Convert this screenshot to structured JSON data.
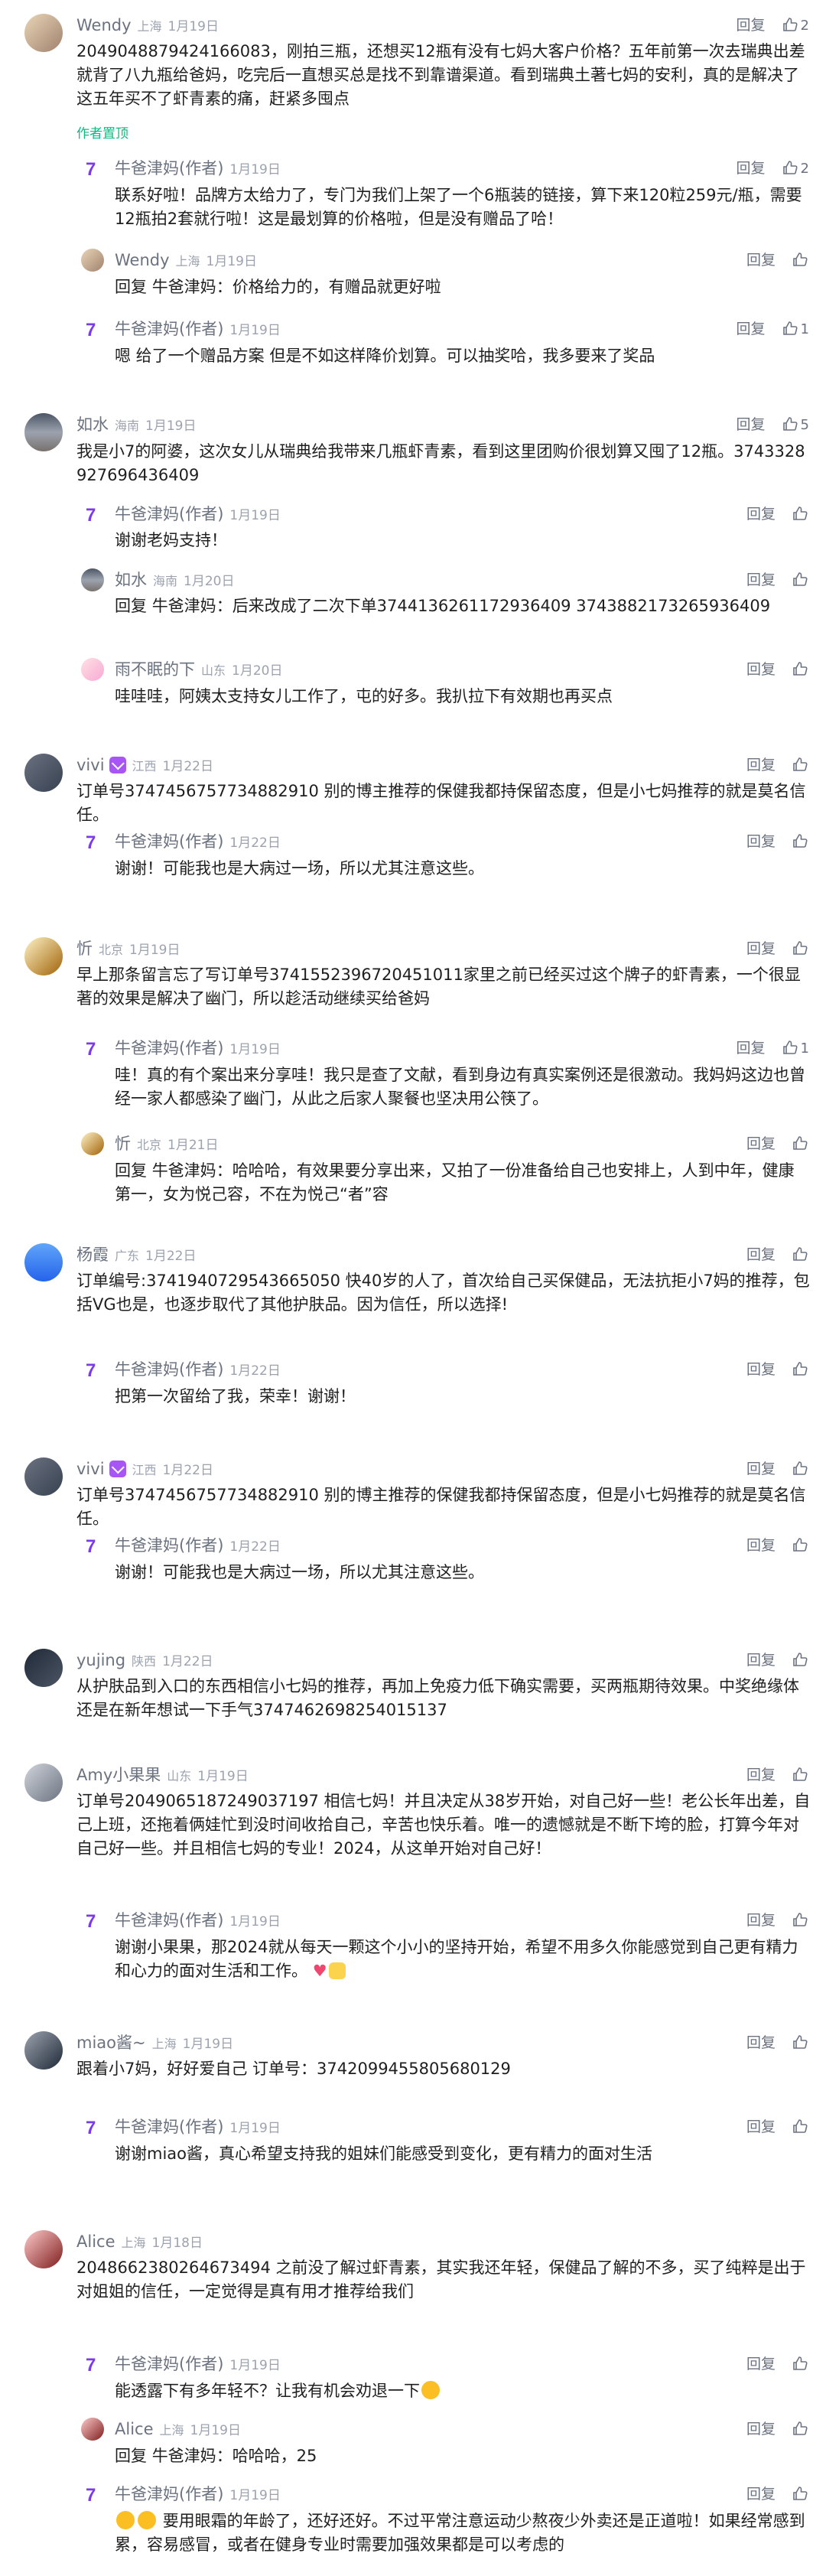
{
  "ui": {
    "reply_label": "回复",
    "author_tag": "(作者)",
    "reply_prefix": "回复",
    "favorite_tag": "作者置顶"
  },
  "colors": {
    "favorite": "#10b981",
    "vip": "#a855f7",
    "meta": "#9ca3af"
  },
  "comments": [
    {
      "user": "Wendy",
      "location": "上海",
      "date": "1月19日",
      "likes": "2",
      "text": "2049048879424166083，刚拍三瓶，还想买12瓶有没有七妈大客户价格？五年前第一次去瑞典出差就背了八九瓶给爸妈，吃完后一直想买总是找不到靠谱渠道。看到瑞典土著七妈的安利，真的是解决了这五年买不了虾青素的痛，赶紧多囤点",
      "replies": [
        {
          "user": "牛爸津妈",
          "location": "",
          "date": "1月19日",
          "likes": "2",
          "text": "联系好啦！品牌方太给力了，专门为我们上架了一个6瓶装的链接，算下来120粒259元/瓶，需要12瓶拍2套就行啦！这是最划算的价格啦，但是没有赠品了哈！"
        },
        {
          "user": "Wendy",
          "location": "上海",
          "date": "1月19日",
          "likes": "",
          "reply_to": "牛爸津妈",
          "text": "价格给力的，有赠品就更好啦"
        },
        {
          "user": "牛爸津妈",
          "location": "",
          "date": "1月19日",
          "likes": "1",
          "text": "嗯 给了一个赠品方案 但是不如这样降价划算。可以抽奖哈，我多要来了奖品"
        }
      ]
    },
    {
      "user": "如水",
      "location": "海南",
      "date": "1月19日",
      "likes": "5",
      "text": "我是小7的阿婆，这次女儿从瑞典给我带来几瓶虾青素，看到这里团购价很划算又囤了12瓶。3743328927696436409",
      "replies": [
        {
          "user": "牛爸津妈",
          "location": "",
          "date": "1月19日",
          "likes": "",
          "text": "谢谢老妈支持！"
        },
        {
          "user": "如水",
          "location": "海南",
          "date": "1月20日",
          "likes": "",
          "reply_to": "牛爸津妈",
          "text": "后来改成了二次下单3744136261172936409 3743882173265936409"
        },
        {
          "user": "雨不眠的下",
          "location": "山东",
          "date": "1月20日",
          "likes": "",
          "text": "哇哇哇，阿姨太支持女儿工作了，屯的好多。我扒拉下有效期也再买点"
        }
      ]
    },
    {
      "user": "vivi",
      "location": "江西",
      "date": "1月22日",
      "likes": "",
      "text": "订单号3747456757734882910 别的博主推荐的保健我都持保留态度，但是小七妈推荐的就是莫名信任。",
      "replies": [
        {
          "user": "牛爸津妈",
          "location": "",
          "date": "1月22日",
          "likes": "",
          "text": "谢谢！可能我也是大病过一场，所以尤其注意这些。"
        }
      ]
    },
    {
      "user": "忻",
      "location": "北京",
      "date": "1月19日",
      "likes": "",
      "text": "早上那条留言忘了写订单号3741552396720451011家里之前已经买过这个牌子的虾青素，一个很显著的效果是解决了幽门，所以趁活动继续买给爸妈",
      "replies": [
        {
          "user": "牛爸津妈",
          "location": "",
          "date": "1月19日",
          "likes": "1",
          "text": "哇！真的有个案出来分享哇！我只是查了文献，看到身边有真实案例还是很激动。我妈妈这边也曾经一家人都感染了幽门，从此之后家人聚餐也坚决用公筷了。"
        },
        {
          "user": "忻",
          "location": "北京",
          "date": "1月21日",
          "likes": "",
          "reply_to": "牛爸津妈",
          "text": "哈哈哈，有效果要分享出来，又拍了一份准备给自己也安排上，人到中年，健康第一，女为悦己容，不在为悦己“者”容"
        }
      ]
    },
    {
      "user": "杨霞",
      "location": "广东",
      "date": "1月22日",
      "likes": "",
      "text": "订单编号:3741940729543665050 快40岁的人了，首次给自己买保健品，无法抗拒小7妈的推荐，包括VG也是，也逐步取代了其他护肤品。因为信任，所以选择!",
      "replies": [
        {
          "user": "牛爸津妈",
          "location": "",
          "date": "1月22日",
          "likes": "",
          "text": "把第一次留给了我，荣幸！谢谢！"
        }
      ]
    },
    {
      "user": "vivi",
      "location": "江西",
      "date": "1月22日",
      "likes": "",
      "text": "订单号3747456757734882910 别的博主推荐的保健我都持保留态度，但是小七妈推荐的就是莫名信任。",
      "replies": [
        {
          "user": "牛爸津妈",
          "location": "",
          "date": "1月22日",
          "likes": "",
          "text": "谢谢！可能我也是大病过一场，所以尤其注意这些。"
        }
      ]
    },
    {
      "user": "yujing",
      "location": "陕西",
      "date": "1月22日",
      "likes": "",
      "text": "从护肤品到入口的东西相信小七妈的推荐，再加上免疫力低下确实需要，买两瓶期待效果。中奖绝缘体还是在新年想试一下手气3747462698254015137",
      "replies": []
    },
    {
      "user": "Amy小果果",
      "location": "山东",
      "date": "1月19日",
      "likes": "",
      "text": "订单号2049065187249037197 相信七妈！并且决定从38岁开始，对自己好一些！老公长年出差，自己上班，还拖着俩娃忙到没时间收拾自己，辛苦也快乐着。唯一的遗憾就是不断下垮的脸，打算今年对自己好一些。并且相信七妈的专业！2024，从这单开始对自己好！",
      "replies": [
        {
          "user": "牛爸津妈",
          "location": "",
          "date": "1月19日",
          "likes": "",
          "text": "谢谢小果果，那2024就从每天一颗这个小小的坚持开始，希望不用多久你能感觉到自己更有精力和心力的面对生活和工作。"
        }
      ]
    },
    {
      "user": "miao酱~",
      "location": "上海",
      "date": "1月19日",
      "likes": "",
      "text": "跟着小7妈，好好爱自己 订单号：3742099455805680129",
      "replies": [
        {
          "user": "牛爸津妈",
          "location": "",
          "date": "1月19日",
          "likes": "",
          "text": "谢谢miao酱，真心希望支持我的姐妹们能感受到变化，更有精力的面对生活"
        }
      ]
    },
    {
      "user": "Alice",
      "location": "上海",
      "date": "1月18日",
      "likes": "",
      "text": "2048662380264673494 之前没了解过虾青素，其实我还年轻，保健品了解的不多，买了纯粹是出于对姐姐的信任，一定觉得是真有用才推荐给我们",
      "replies": [
        {
          "user": "牛爸津妈",
          "location": "",
          "date": "1月19日",
          "likes": "",
          "text": "能透露下有多年轻不？让我有机会劝退一下"
        },
        {
          "user": "Alice",
          "location": "上海",
          "date": "1月19日",
          "likes": "",
          "reply_to": "牛爸津妈",
          "text": "哈哈哈，25"
        },
        {
          "user": "牛爸津妈",
          "location": "",
          "date": "1月19日",
          "likes": "",
          "text": "要用眼霜的年龄了，还好还好。不过平常注意运动少熬夜少外卖还是正道啦！如果经常感到累，容易感冒，或者在健身专业时需要加强效果都是可以考虑的"
        }
      ]
    }
  ]
}
